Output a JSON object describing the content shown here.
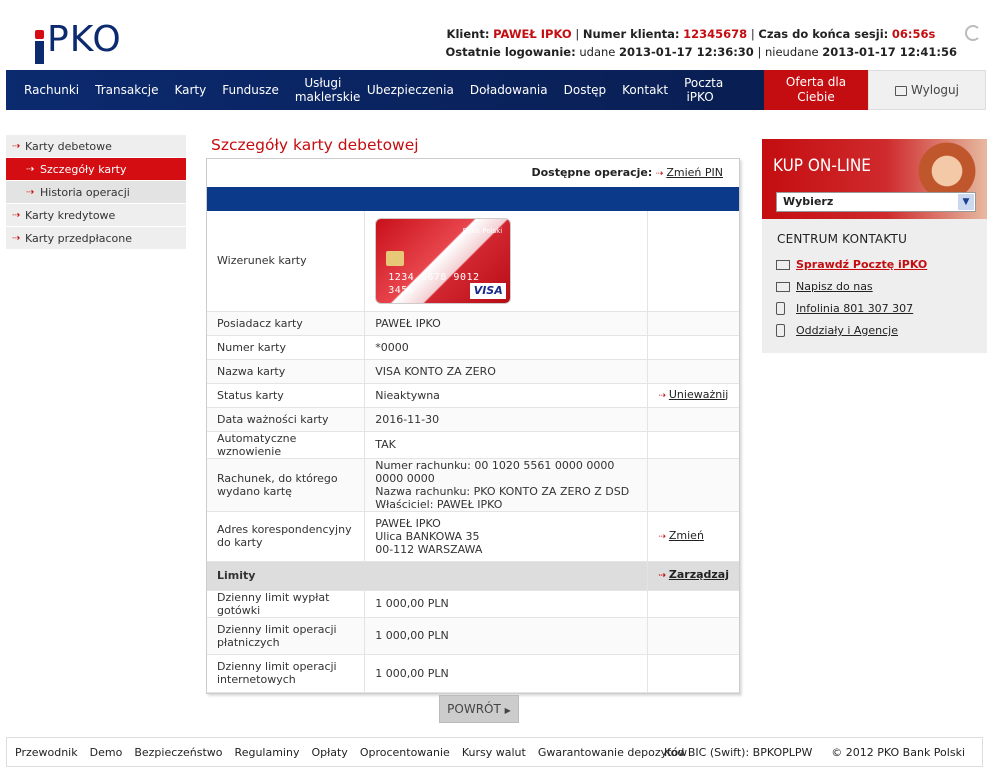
{
  "brand": {
    "logo": "PKO"
  },
  "session": {
    "client_label": "Klient:",
    "client_name": "PAWEŁ IPKO",
    "client_no_label": "Numer klienta:",
    "client_no": "12345678",
    "timer_label": "Czas do końca sesji:",
    "timer": "06:56s",
    "last_login_label": "Ostatnie logowanie:",
    "ok_label": "udane",
    "ok_time": "2013-01-17 12:36:30",
    "fail_label": "nieudane",
    "fail_time": "2013-01-17 12:41:56"
  },
  "nav": {
    "items": [
      "Rachunki",
      "Transakcje",
      "Karty",
      "Fundusze",
      "Usługi maklerskie",
      "Ubezpieczenia",
      "Doładowania",
      "Dostęp",
      "Kontakt",
      "Poczta iPKO"
    ],
    "offer": "Oferta dla Ciebie",
    "logout": "Wyloguj"
  },
  "sidebar": {
    "items": [
      "Karty debetowe",
      "Szczegóły karty debetowej",
      "Historia operacji",
      "Karty kredytowe",
      "Karty przedpłacone"
    ]
  },
  "main": {
    "title": "Szczegóły karty debetowej",
    "ops_label": "Dostępne operacje:",
    "ops_link": "Zmień PIN",
    "card": {
      "number": "1234 5678 9012 3456",
      "bank": "Bank Polski",
      "visa": "VISA"
    },
    "rows": [
      {
        "label": "Wizerunek karty",
        "value": "",
        "action": ""
      },
      {
        "label": "Posiadacz karty",
        "value": "PAWEŁ IPKO",
        "action": ""
      },
      {
        "label": "Numer karty",
        "value": "*0000",
        "action": ""
      },
      {
        "label": "Nazwa karty",
        "value": "VISA KONTO ZA ZERO",
        "action": ""
      },
      {
        "label": "Status karty",
        "value": "Nieaktywna",
        "action": "Unieważnij"
      },
      {
        "label": "Data ważności karty",
        "value": "2016-11-30",
        "action": ""
      },
      {
        "label": "Automatyczne wznowienie",
        "value": "TAK",
        "action": ""
      },
      {
        "label": "Rachunek, do którego wydano kartę",
        "value1": "Numer rachunku: 00 1020 5561 0000 0000 0000 0000",
        "value2": "Nazwa rachunku: PKO KONTO ZA ZERO Z DSD",
        "value3": "Właściciel: PAWEŁ IPKO"
      },
      {
        "label": "Adres korespondencyjny do karty",
        "value1": "PAWEŁ IPKO",
        "value2": "Ulica BANKOWA 35",
        "value3": "00-112 WARSZAWA",
        "action": "Zmień"
      }
    ],
    "limits_label": "Limity",
    "limits_action": "Zarządzaj",
    "limits": [
      {
        "label": "Dzienny limit wypłat gotówki",
        "value": "1 000,00 PLN"
      },
      {
        "label": "Dzienny limit operacji płatniczych",
        "value": "1 000,00 PLN"
      },
      {
        "label": "Dzienny limit operacji internetowych",
        "value": "1 000,00 PLN"
      }
    ],
    "back_button": "POWRÓT"
  },
  "promo": {
    "title": "KUP ON-LINE",
    "select_value": "Wybierz"
  },
  "contact": {
    "title": "CENTRUM KONTAKTU",
    "items": [
      "Sprawdź Pocztę iPKO",
      "Napisz do nas",
      "Infolinia 801 307 307",
      "Oddziały i Agencje"
    ]
  },
  "footer": {
    "links": [
      "Przewodnik",
      "Demo",
      "Bezpieczeństwo",
      "Regulaminy",
      "Opłaty",
      "Oprocentowanie",
      "Kursy walut",
      "Gwarantowanie depozytów"
    ],
    "bic": "Kod BIC (Swift): BPKOPLPW",
    "copyright": "© 2012 PKO Bank Polski"
  }
}
